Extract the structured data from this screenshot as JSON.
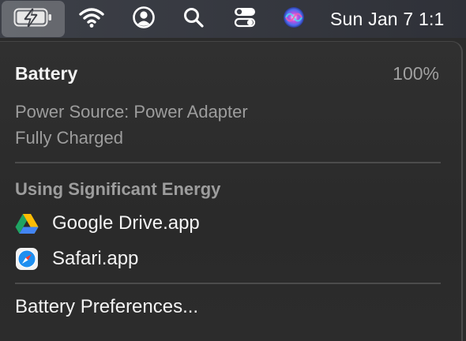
{
  "menubar": {
    "icons": {
      "battery": "battery-charging-icon",
      "wifi": "wifi-icon",
      "user": "user-account-icon",
      "search": "spotlight-search-icon",
      "control_center": "control-center-icon",
      "siri": "siri-icon"
    },
    "clock": "Sun Jan 7  1:1"
  },
  "battery_menu": {
    "title": "Battery",
    "percent": "100%",
    "power_source": "Power Source: Power Adapter",
    "status": "Fully Charged",
    "energy_section_label": "Using Significant Energy",
    "apps": [
      {
        "label": "Google Drive.app",
        "icon": "google-drive-icon"
      },
      {
        "label": "Safari.app",
        "icon": "safari-icon"
      }
    ],
    "preferences_label": "Battery Preferences..."
  },
  "colors": {
    "panel_bg": "#2c2c2c",
    "menubar_bg": "#373a42",
    "primary_text": "#f4f4f4",
    "secondary_text": "#9d9d9d",
    "divider": "#4c4c4c"
  }
}
